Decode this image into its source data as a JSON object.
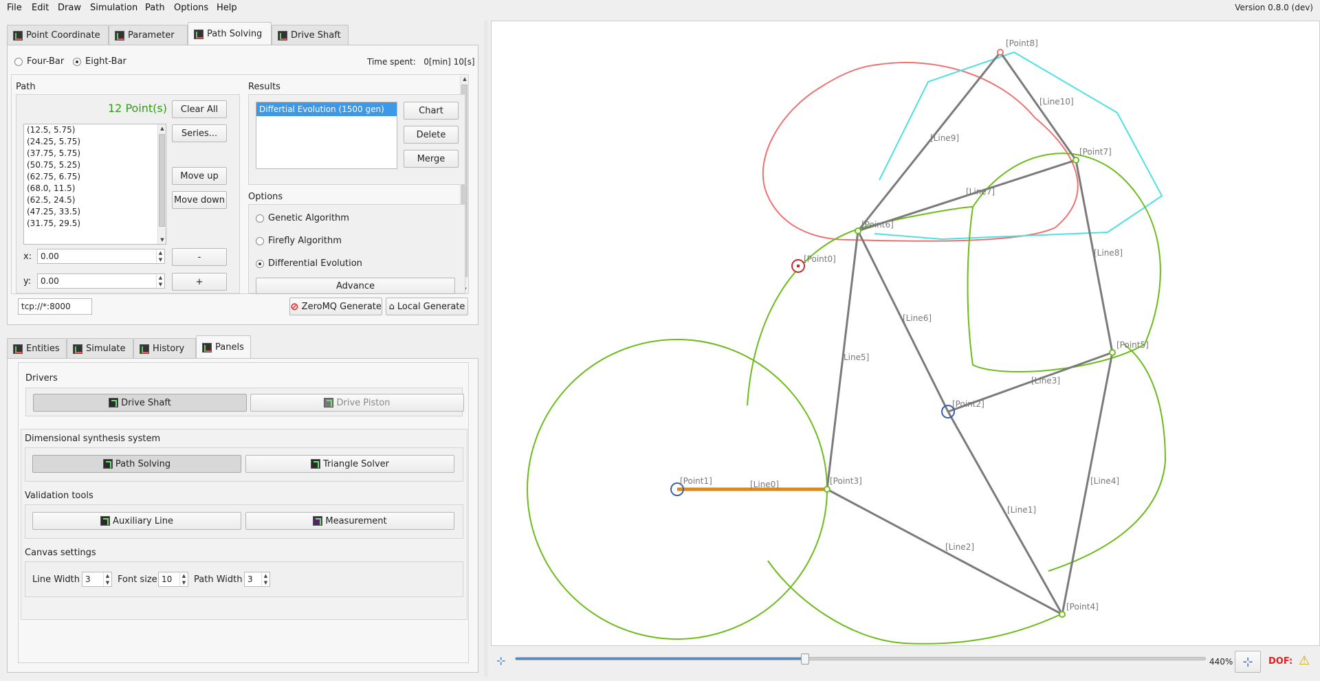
{
  "menu": [
    "File",
    "Edit",
    "Draw",
    "Simulation",
    "Path",
    "Options",
    "Help"
  ],
  "version": "Version 0.8.0 (dev)",
  "top_tabs": [
    {
      "label": "Point Coordinate",
      "active": false
    },
    {
      "label": "Parameter",
      "active": false
    },
    {
      "label": "Path Solving",
      "active": true
    },
    {
      "label": "Drive Shaft",
      "active": false
    }
  ],
  "path_solving": {
    "four_bar": "Four-Bar",
    "eight_bar": "Eight-Bar",
    "selected_type": "Eight-Bar",
    "time_spent": "Time spent:   0[min] 10[s]",
    "path_label": "Path",
    "points_count": "12 Point(s)",
    "points_color": "#2e9e16",
    "clear_all": "Clear All",
    "series": "Series...",
    "move_up": "Move up",
    "move_down": "Move down",
    "points": [
      "(12.5, 5.75)",
      "(24.25, 5.75)",
      "(37.75, 5.75)",
      "(50.75, 5.25)",
      "(62.75, 6.75)",
      "(68.0, 11.5)",
      "(62.5, 24.5)",
      "(47.25, 33.5)",
      "(31.75, 29.5)"
    ],
    "x_label": "x:",
    "x_value": "0.00",
    "y_label": "y:",
    "y_value": "0.00",
    "minus": "-",
    "plus": "+",
    "results_label": "Results",
    "results": [
      "Differtial Evolution (1500 gen)"
    ],
    "chart": "Chart",
    "delete": "Delete",
    "merge": "Merge",
    "options_label": "Options",
    "algorithms": [
      "Genetic Algorithm",
      "Firefly Algorithm",
      "Differential Evolution"
    ],
    "selected_algorithm": "Differential Evolution",
    "advance": "Advance",
    "address": "tcp://*:8000",
    "zmq_generate": "ZeroMQ Generate",
    "local_generate": "Local Generate"
  },
  "bottom_tabs": [
    {
      "label": "Entities",
      "active": false
    },
    {
      "label": "Simulate",
      "active": false
    },
    {
      "label": "History",
      "active": false
    },
    {
      "label": "Panels",
      "active": true
    }
  ],
  "panels": {
    "drivers_label": "Drivers",
    "drive_shaft": "Drive Shaft",
    "drive_piston": "Drive Piston",
    "synthesis_label": "Dimensional synthesis system",
    "path_solving": "Path Solving",
    "triangle_solver": "Triangle Solver",
    "validation_label": "Validation tools",
    "auxiliary_line": "Auxiliary Line",
    "measurement": "Measurement",
    "canvas_label": "Canvas settings",
    "line_width_label": "Line Width",
    "line_width": "3",
    "font_size_label": "Font size",
    "font_size": "10",
    "path_width_label": "Path Width",
    "path_width": "3"
  },
  "canvas": {
    "points": [
      {
        "name": "[Point0]"
      },
      {
        "name": "[Point1]"
      },
      {
        "name": "[Point2]"
      },
      {
        "name": "[Point3]"
      },
      {
        "name": "[Point4]"
      },
      {
        "name": "[Point5]"
      },
      {
        "name": "[Point6]"
      },
      {
        "name": "[Point7]"
      },
      {
        "name": "[Point8]"
      }
    ],
    "lines": [
      "[Line0]",
      "[Line1]",
      "[Line2]",
      "[Line3]",
      "[Line4]",
      "Line5]",
      "[Line6]",
      "[Line7]",
      "[Line8]",
      "[Line9]",
      "[Line10]"
    ],
    "colors": {
      "driver": "#d88a1c",
      "link": "#7a7a7a",
      "path": "#6cbb1a",
      "target": "#4ee0e0",
      "result": "#f07070"
    }
  },
  "zoom": {
    "label": "440%",
    "level": 0.42
  },
  "dof_label": "DOF:"
}
